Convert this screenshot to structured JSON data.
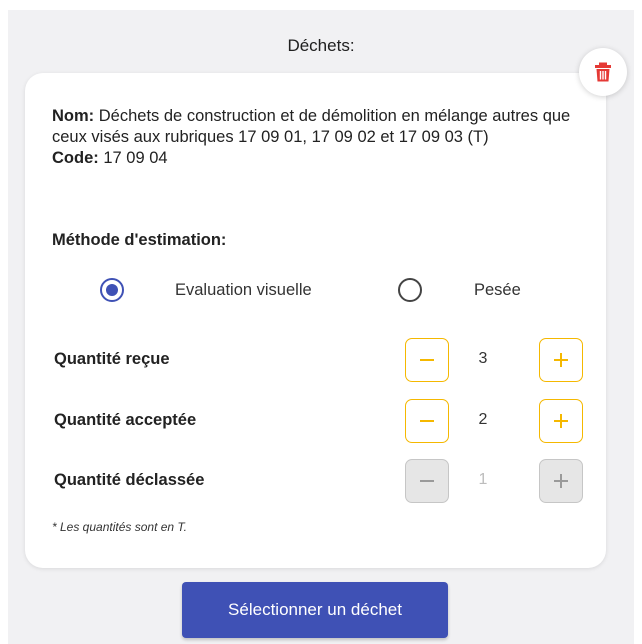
{
  "section": {
    "title": "Déchets:"
  },
  "waste": {
    "name_label": "Nom:",
    "name_value": "Déchets de construction et de démolition en mélange autres que ceux visés aux rubriques 17 09 01, 17 09 02 et 17 09 03 (T)",
    "code_label": "Code:",
    "code_value": "17 09 04"
  },
  "estimation": {
    "label": "Méthode d'estimation:",
    "options": [
      {
        "label": "Evaluation visuelle",
        "selected": true
      },
      {
        "label": "Pesée",
        "selected": false
      }
    ]
  },
  "quantities": [
    {
      "label": "Quantité reçue",
      "value": "3",
      "enabled": true
    },
    {
      "label": "Quantité acceptée",
      "value": "2",
      "enabled": true
    },
    {
      "label": "Quantité déclassée",
      "value": "1",
      "enabled": false
    }
  ],
  "note": "* Les quantités sont en T.",
  "actions": {
    "select_waste": "Sélectionner un déchet"
  },
  "icons": {
    "delete": "trash-icon",
    "decrement": "minus-icon",
    "increment": "plus-icon"
  },
  "colors": {
    "primary": "#3f51b5",
    "stepper_border": "#f5b800",
    "delete_red": "#e53935",
    "disabled_fill": "#e6e6e6"
  }
}
